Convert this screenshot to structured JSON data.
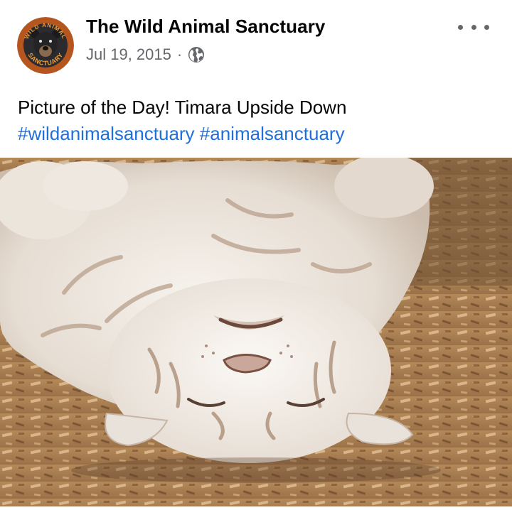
{
  "post": {
    "page_name": "The Wild Animal Sanctuary",
    "date": "Jul 19, 2015",
    "separator": "·",
    "privacy_icon": "globe-icon",
    "more_icon": "more-options-icon",
    "caption": "Picture of the Day! Timara Upside Down",
    "hashtags": [
      "#wildanimalsanctuary",
      "#animalsanctuary"
    ]
  },
  "avatar": {
    "logo_text_top": "WILD ANIMAL",
    "logo_text_bottom": "SANCTUARY",
    "icon": "bear-logo-icon"
  },
  "photo": {
    "subject": "white tiger lying upside down on wood chips"
  },
  "colors": {
    "name_text": "#050505",
    "meta_text": "#65676b",
    "hashtag": "#216fdb",
    "background": "#ffffff"
  }
}
